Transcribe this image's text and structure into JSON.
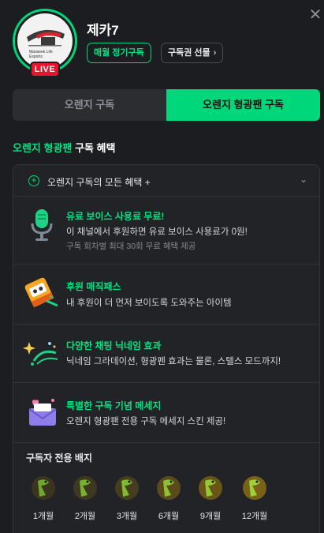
{
  "close_icon": "close-icon",
  "streamer": {
    "name": "제카7",
    "live_label": "LIVE",
    "avatar_text": "Manseek Life Esports"
  },
  "header_buttons": {
    "monthly_label": "매월 정기구독",
    "gift_label": "구독권 선물",
    "gift_chevron": "›"
  },
  "tabs": [
    {
      "label": "오렌지 구독",
      "active": false
    },
    {
      "label": "오렌지 형광팬 구독",
      "active": true
    }
  ],
  "section": {
    "title_highlight": "오렌지 형광팬",
    "title_rest": " 구독 혜택"
  },
  "all_benefits": {
    "label": "오렌지 구독의 모든 혜택 +",
    "plus": "+",
    "chevron": "⌄"
  },
  "benefits": [
    {
      "icon": "microphone-icon",
      "title": "유료 보이스 사용료 무료!",
      "desc": "이 채널에서 후원하면 유료 보이스 사용료가 0원!",
      "sub": "구독 회차별 최대 30회 무료 혜택 제공"
    },
    {
      "icon": "magic-pass-icon",
      "title": "후원 매직패스",
      "desc": "내 후원이 더 먼저 보이도록 도와주는 아이템",
      "sub": ""
    },
    {
      "icon": "sparkle-effect-icon",
      "title": "다양한 채팅 닉네임 효과",
      "desc": "닉네임 그라데이션, 형광펜 효과는 물론, 스텔스 모드까지!",
      "sub": ""
    },
    {
      "icon": "envelope-icon",
      "title": "특별한 구독 기념 메세지",
      "desc": "오렌지 형광팬 전용 구독 메세지 스킨 제공!",
      "sub": ""
    }
  ],
  "badges": {
    "title": "구독자 전용 배지",
    "items": [
      {
        "label": "1개월"
      },
      {
        "label": "2개월"
      },
      {
        "label": "3개월"
      },
      {
        "label": "6개월"
      },
      {
        "label": "9개월"
      },
      {
        "label": "12개월"
      }
    ]
  },
  "colors": {
    "accent_green": "#00d67a",
    "live_red": "#e8132f",
    "background": "#1c1d20"
  }
}
